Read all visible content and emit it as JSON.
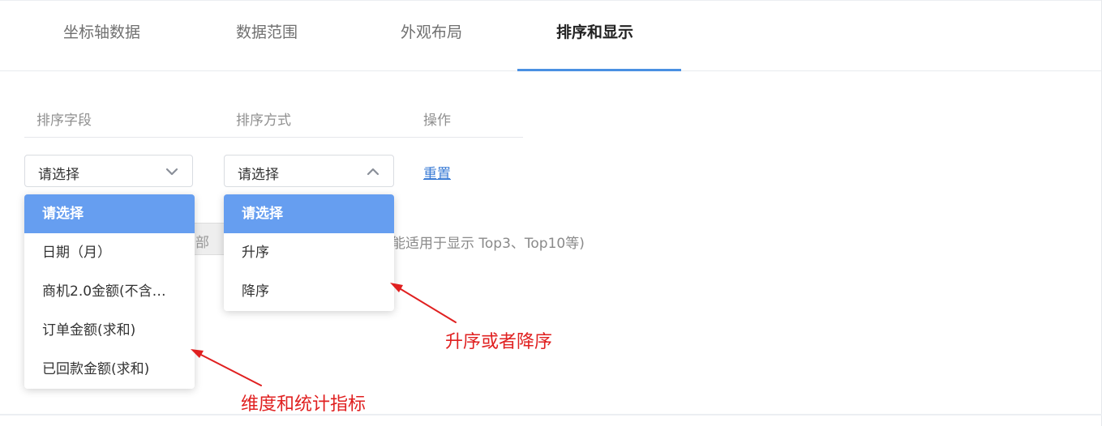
{
  "tabs": [
    {
      "label": "坐标轴数据",
      "active": false
    },
    {
      "label": "数据范围",
      "active": false
    },
    {
      "label": "外观布局",
      "active": false
    },
    {
      "label": "排序和显示",
      "active": true
    }
  ],
  "table": {
    "headers": [
      "排序字段",
      "排序方式",
      "操作"
    ]
  },
  "sort_field_select": {
    "value": "请选择",
    "state": "open",
    "icon": "chevron-down-icon",
    "options": [
      "请选择",
      "日期（月）",
      "商机2.0金额(不含…",
      "订单金额(求和)",
      "已回款金额(求和)"
    ],
    "selected_index": 0
  },
  "sort_order_select": {
    "value": "请选择",
    "state": "open",
    "icon": "chevron-up-icon",
    "options": [
      "请选择",
      "升序",
      "降序"
    ],
    "selected_index": 0
  },
  "reset_label": "重置",
  "obscured": {
    "button_fragment": "部",
    "hint_fragment": "能适用于显示 Top3、Top10等)"
  },
  "annotations": {
    "order_note": "升序或者降序",
    "field_note": "维度和统计指标",
    "color": "#e02020"
  },
  "colors": {
    "accent": "#4a90e2",
    "selected_option_bg": "#669ef0",
    "link": "#3a7bd5"
  }
}
